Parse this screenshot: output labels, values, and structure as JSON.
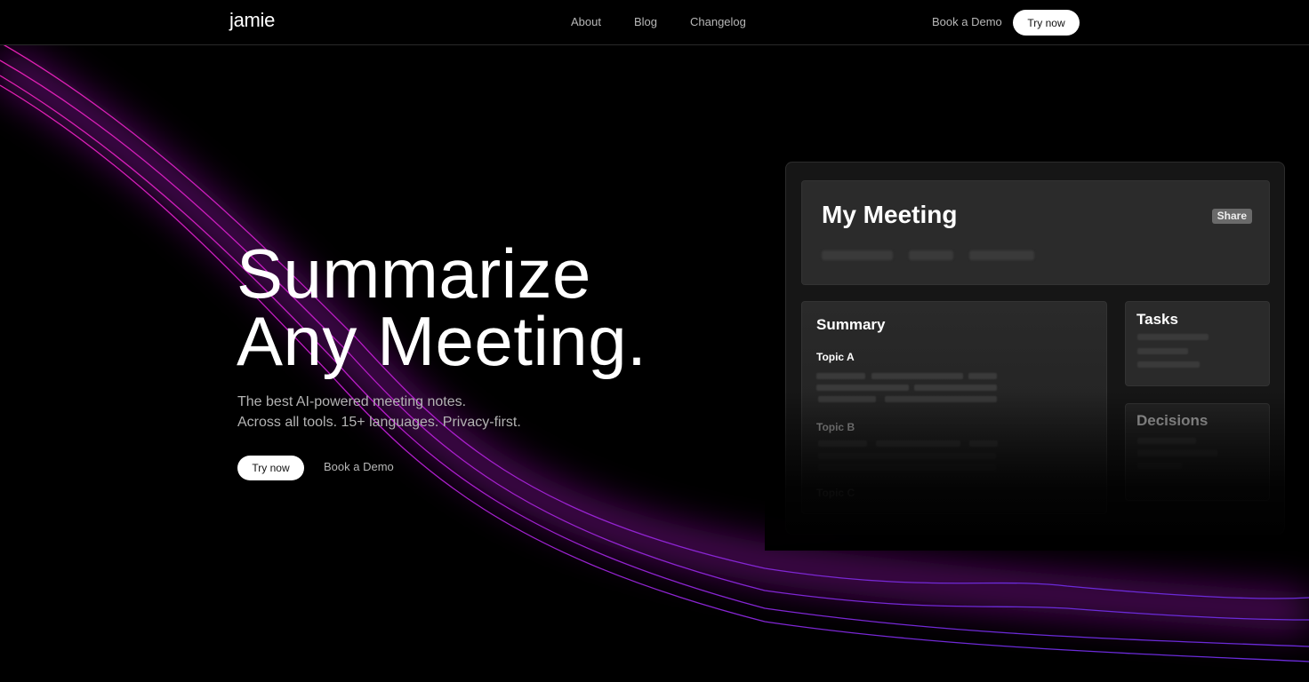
{
  "nav": {
    "logo": "jamie",
    "links": [
      "About",
      "Blog",
      "Changelog"
    ],
    "book_demo": "Book a Demo",
    "try_now": "Try now"
  },
  "hero": {
    "title_line1": "Summarize",
    "title_line2": "Any Meeting.",
    "subtitle_line1": "The best AI-powered meeting notes.",
    "subtitle_line2": "Across all tools. 15+ languages. Privacy-first.",
    "try_now": "Try now",
    "book_demo": "Book a Demo"
  },
  "mockup": {
    "meeting_title": "My Meeting",
    "share_label": "Share",
    "summary": {
      "title": "Summary",
      "topics": [
        "Topic A",
        "Topic B",
        "Topic C"
      ]
    },
    "tasks_title": "Tasks",
    "decisions_title": "Decisions"
  },
  "colors": {
    "background": "#000000",
    "wave_pink": "#d01fb5",
    "wave_violet": "#7a2be0",
    "card": "#2a2a2a"
  }
}
